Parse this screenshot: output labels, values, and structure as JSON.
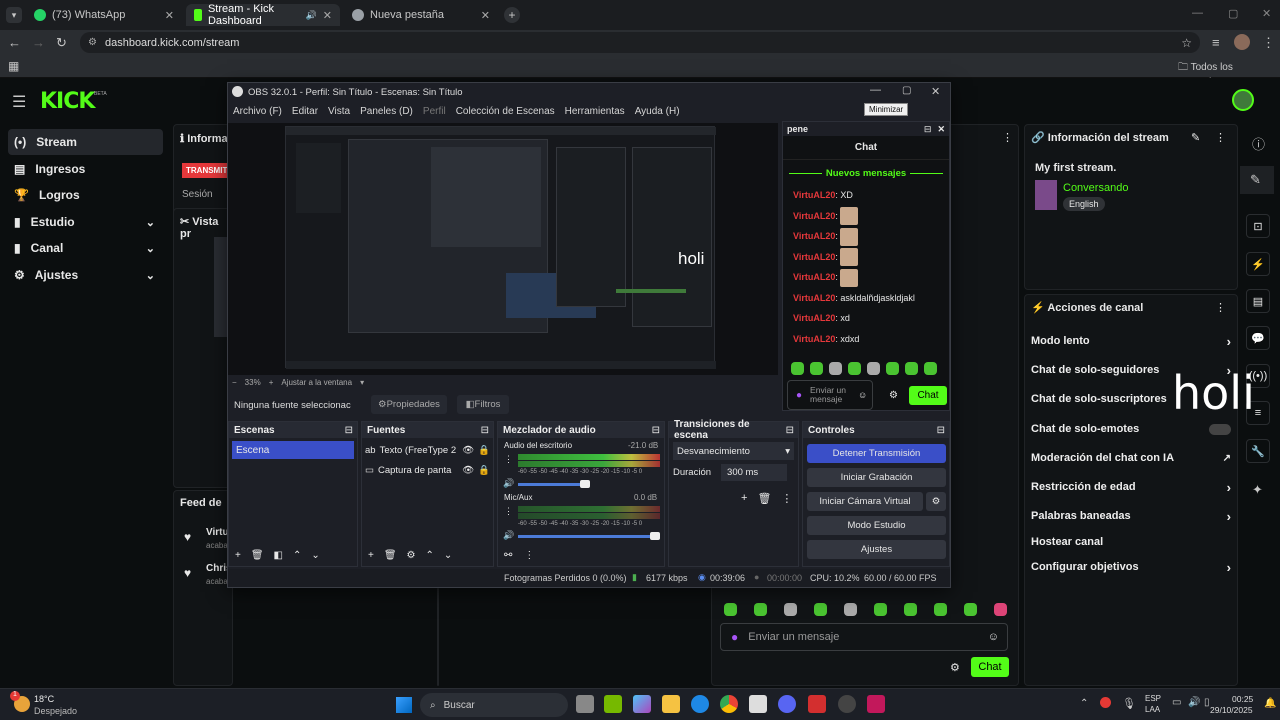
{
  "browser": {
    "tabs": [
      {
        "label": "(73) WhatsApp",
        "color": "#25d366"
      },
      {
        "label": "Stream - Kick Dashboard",
        "color": "#53fc18"
      },
      {
        "label": "Nueva pestaña",
        "color": "#9aa0a6"
      }
    ],
    "url": "dashboard.kick.com/stream",
    "bookmarks_label": "Todos los marcadores"
  },
  "kick": {
    "logo": "KICK",
    "logo_badge": "BETA",
    "sidebar": [
      {
        "label": "Stream",
        "icon": "(•)"
      },
      {
        "label": "Ingresos",
        "icon": "▤"
      },
      {
        "label": "Logros",
        "icon": "🏆"
      },
      {
        "label": "Estudio",
        "icon": "▮"
      },
      {
        "label": "Canal",
        "icon": "▮"
      },
      {
        "label": "Ajustes",
        "icon": "⚙"
      }
    ],
    "info_partial": "Informa",
    "transmit_partial": "TRANSMIT",
    "session_label": "Sesión",
    "preview_partial": "Vista pr",
    "feed_partial": "Feed de",
    "feed_items": [
      {
        "name": "Virtu",
        "sub": "acaba"
      },
      {
        "name": "Chris",
        "sub": "acaba"
      }
    ],
    "stream_info": {
      "header": "Información del stream",
      "title": "My first stream.",
      "category": "Conversando",
      "language": "English"
    },
    "channel_actions": {
      "header": "Acciones de canal",
      "items": [
        "Modo lento",
        "Chat de solo-seguidores",
        "Chat de solo-suscriptores",
        "Chat de solo-emotes",
        "Moderación del chat con IA",
        "Restricción de edad",
        "Palabras baneadas",
        "Hostear canal",
        "Configurar objetivos"
      ]
    },
    "overlay_text": "holi",
    "chat_placeholder": "Enviar un mensaje",
    "chat_button": "Chat"
  },
  "obs": {
    "title": "OBS 32.0.1 - Perfil: Sin Título - Escenas: Sin Título",
    "tooltip": "Minimizar",
    "menu": [
      "Archivo (F)",
      "Editar",
      "Vista",
      "Paneles (D)",
      "Perfil",
      "Colección de Escenas",
      "Herramientas",
      "Ayuda (H)"
    ],
    "zoom": "33%",
    "fit_label": "Ajustar a la ventana",
    "no_source": "Ninguna fuente seleccionac",
    "props": "Propiedades",
    "filters": "Filtros",
    "preview_text": "holi",
    "scenes": {
      "header": "Escenas",
      "items": [
        "Escena"
      ]
    },
    "sources": {
      "header": "Fuentes",
      "items": [
        "Texto (FreeType 2",
        "Captura de panta"
      ]
    },
    "mixer": {
      "header": "Mezclador de audio",
      "channels": [
        {
          "name": "Audio del escritorio",
          "db": "-21.0 dB"
        },
        {
          "name": "Mic/Aux",
          "db": "0.0 dB"
        }
      ],
      "scale": "-60 -55 -50 -45 -40 -35 -30 -25 -20 -15 -10 -5 0"
    },
    "transitions": {
      "header": "Transiciones de escena",
      "value": "Desvanecimiento",
      "duration_label": "Duración",
      "duration_value": "300 ms"
    },
    "controls": {
      "header": "Controles",
      "buttons": [
        "Detener Transmisión",
        "Iniciar Grabación",
        "Iniciar Cámara Virtual",
        "Modo Estudio",
        "Ajustes"
      ]
    },
    "status": {
      "dropped": "Fotogramas Perdidos 0 (0.0%)",
      "kbps": "6177 kbps",
      "live_time": "00:39:06",
      "rec_time": "00:00:00",
      "cpu": "CPU: 10.2%",
      "fps": "60.00 / 60.00 FPS"
    },
    "chat_dock": {
      "title": "pene",
      "header": "Chat",
      "new_messages": "Nuevos mensajes",
      "messages": [
        {
          "user": "VirtuAL20",
          "text": ": XD",
          "emote": false
        },
        {
          "user": "VirtuAL20",
          "text": ":",
          "emote": true
        },
        {
          "user": "VirtuAL20",
          "text": ":",
          "emote": true
        },
        {
          "user": "VirtuAL20",
          "text": ":",
          "emote": true
        },
        {
          "user": "VirtuAL20",
          "text": ":",
          "emote": true
        },
        {
          "user": "VirtuAL20",
          "text": ": askldalñdjaskldjakl",
          "emote": false
        },
        {
          "user": "VirtuAL20",
          "text": ": xd",
          "emote": false
        },
        {
          "user": "VirtuAL20",
          "text": ": xdxd",
          "emote": false
        }
      ],
      "placeholder": "Enviar un mensaje",
      "send": "Chat"
    }
  },
  "taskbar": {
    "temp": "18°C",
    "weather": "Despejado",
    "search": "Buscar",
    "lang1": "ESP",
    "lang2": "LAA",
    "time": "00:25",
    "date": "29/10/2025",
    "weather_badge": "1"
  }
}
